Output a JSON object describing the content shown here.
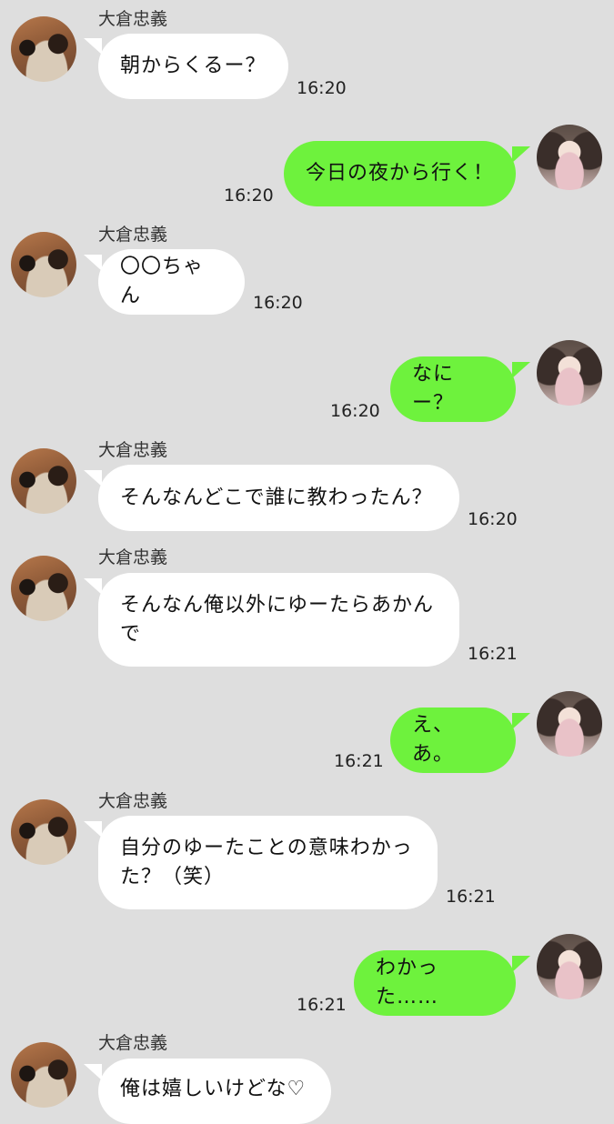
{
  "contact": {
    "name": "大倉忠義"
  },
  "messages": [
    {
      "sender": "other",
      "text": "朝からくるー？",
      "time": "16:20"
    },
    {
      "sender": "self",
      "text": "今日の夜から行く！",
      "time": "16:20"
    },
    {
      "sender": "other",
      "text": "〇〇ちゃん",
      "time": "16:20"
    },
    {
      "sender": "self",
      "text": "なにー？",
      "time": "16:20"
    },
    {
      "sender": "other",
      "text": "そんなんどこで誰に教わったん？",
      "time": "16:20"
    },
    {
      "sender": "other",
      "text": "そんなん俺以外にゆーたらあかんで",
      "line1": "そんなん俺以外にゆーたらあかん",
      "line2": "で",
      "time": "16:21"
    },
    {
      "sender": "self",
      "text": "え、あ。",
      "time": "16:21"
    },
    {
      "sender": "other",
      "text": "自分のゆーたことの意味わかった？（笑）",
      "line1": "自分のゆーたことの意味わかっ",
      "line2": "た？（笑）",
      "time": "16:21"
    },
    {
      "sender": "self",
      "text": "わかった……",
      "time": "16:21"
    },
    {
      "sender": "other",
      "text": "俺は嬉しいけどな♡"
    }
  ]
}
